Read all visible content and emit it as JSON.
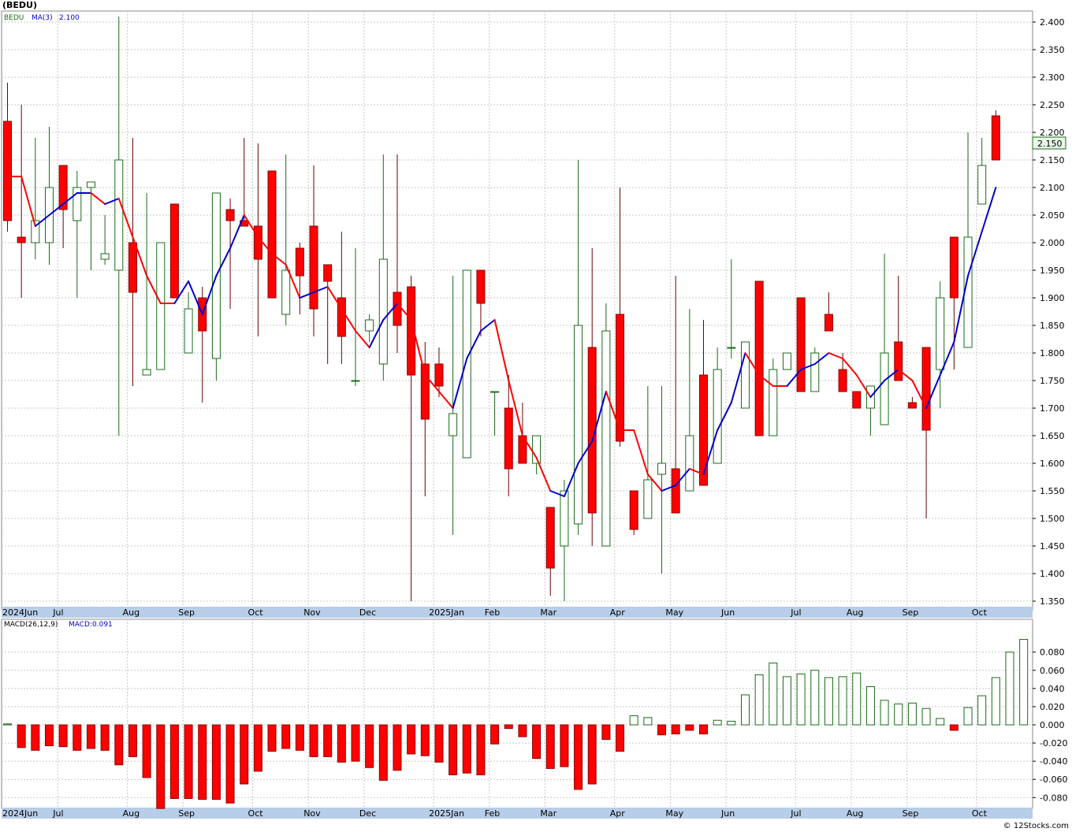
{
  "title": "(BEDU)",
  "copyright": "© 12Stocks.com",
  "colors": {
    "up": "#1a6b1a",
    "down": "#ff0000",
    "ma_up": "#0000cc",
    "ma_down": "#ff0000",
    "axis_band": "#b7cde8",
    "grid": "#c8c8c8"
  },
  "chart_data": [
    {
      "type": "candlestick",
      "legend": {
        "symbol": "BEDU",
        "ma_label": "MA(3)",
        "ma_value": "2.100"
      },
      "price_label": "2.150",
      "ylim": [
        1.34,
        2.42
      ],
      "y_ticks": [
        "1.350",
        "1.400",
        "1.450",
        "1.500",
        "1.550",
        "1.600",
        "1.650",
        "1.700",
        "1.750",
        "1.800",
        "1.850",
        "1.900",
        "1.950",
        "2.000",
        "2.050",
        "2.100",
        "2.150",
        "2.200",
        "2.250",
        "2.300",
        "2.350",
        "2.400"
      ],
      "x_ticks": [
        {
          "i": 0,
          "label": "2024Jun"
        },
        {
          "i": 4,
          "label": "Jul"
        },
        {
          "i": 9,
          "label": "Aug"
        },
        {
          "i": 13,
          "label": "Sep"
        },
        {
          "i": 18,
          "label": "Oct"
        },
        {
          "i": 22,
          "label": "Nov"
        },
        {
          "i": 26,
          "label": "Dec"
        },
        {
          "i": 31,
          "label": "2025Jan"
        },
        {
          "i": 35,
          "label": "Feb"
        },
        {
          "i": 39,
          "label": "Mar"
        },
        {
          "i": 44,
          "label": "Apr"
        },
        {
          "i": 48,
          "label": "May"
        },
        {
          "i": 52,
          "label": "Jun"
        },
        {
          "i": 57,
          "label": "Jul"
        },
        {
          "i": 61,
          "label": "Aug"
        },
        {
          "i": 65,
          "label": "Sep"
        },
        {
          "i": 70,
          "label": "Oct"
        }
      ],
      "candles": [
        {
          "o": 2.22,
          "h": 2.29,
          "l": 2.02,
          "c": 2.04
        },
        {
          "o": 2.01,
          "h": 2.25,
          "l": 1.9,
          "c": 2.0
        },
        {
          "o": 2.0,
          "h": 2.19,
          "l": 1.97,
          "c": 2.04
        },
        {
          "o": 2.0,
          "h": 2.21,
          "l": 1.96,
          "c": 2.1
        },
        {
          "o": 2.14,
          "h": 2.14,
          "l": 1.99,
          "c": 2.06
        },
        {
          "o": 2.04,
          "h": 2.13,
          "l": 1.9,
          "c": 2.1
        },
        {
          "o": 2.1,
          "h": 2.11,
          "l": 1.95,
          "c": 2.11
        },
        {
          "o": 1.97,
          "h": 2.05,
          "l": 1.96,
          "c": 1.98
        },
        {
          "o": 1.95,
          "h": 2.41,
          "l": 1.65,
          "c": 2.15
        },
        {
          "o": 2.0,
          "h": 2.19,
          "l": 1.74,
          "c": 1.91
        },
        {
          "o": 1.76,
          "h": 2.09,
          "l": 1.76,
          "c": 1.77
        },
        {
          "o": 1.77,
          "h": 2.0,
          "l": 1.77,
          "c": 2.0
        },
        {
          "o": 2.07,
          "h": 2.07,
          "l": 1.9,
          "c": 1.9
        },
        {
          "o": 1.8,
          "h": 1.91,
          "l": 1.8,
          "c": 1.88
        },
        {
          "o": 1.9,
          "h": 1.92,
          "l": 1.71,
          "c": 1.84
        },
        {
          "o": 1.79,
          "h": 2.09,
          "l": 1.75,
          "c": 2.09
        },
        {
          "o": 2.06,
          "h": 2.08,
          "l": 1.88,
          "c": 2.04
        },
        {
          "o": 2.04,
          "h": 2.19,
          "l": 2.03,
          "c": 2.03
        },
        {
          "o": 2.03,
          "h": 2.18,
          "l": 1.83,
          "c": 1.97
        },
        {
          "o": 2.13,
          "h": 2.13,
          "l": 1.9,
          "c": 1.9
        },
        {
          "o": 1.87,
          "h": 2.16,
          "l": 1.85,
          "c": 1.95
        },
        {
          "o": 1.99,
          "h": 2.0,
          "l": 1.87,
          "c": 1.94
        },
        {
          "o": 2.03,
          "h": 2.14,
          "l": 1.83,
          "c": 1.88
        },
        {
          "o": 1.96,
          "h": 1.96,
          "l": 1.78,
          "c": 1.93
        },
        {
          "o": 1.9,
          "h": 2.02,
          "l": 1.78,
          "c": 1.83
        },
        {
          "o": 1.75,
          "h": 1.99,
          "l": 1.74,
          "c": 1.75
        },
        {
          "o": 1.84,
          "h": 1.87,
          "l": 1.82,
          "c": 1.86
        },
        {
          "o": 1.78,
          "h": 2.16,
          "l": 1.75,
          "c": 1.97
        },
        {
          "o": 1.91,
          "h": 2.16,
          "l": 1.8,
          "c": 1.85
        },
        {
          "o": 1.92,
          "h": 1.94,
          "l": 1.35,
          "c": 1.76
        },
        {
          "o": 1.78,
          "h": 1.82,
          "l": 1.54,
          "c": 1.68
        },
        {
          "o": 1.78,
          "h": 1.81,
          "l": 1.72,
          "c": 1.74
        },
        {
          "o": 1.65,
          "h": 1.94,
          "l": 1.47,
          "c": 1.69
        },
        {
          "o": 1.61,
          "h": 1.95,
          "l": 1.61,
          "c": 1.95
        },
        {
          "o": 1.95,
          "h": 1.95,
          "l": 1.83,
          "c": 1.89
        },
        {
          "o": 1.73,
          "h": 1.73,
          "l": 1.65,
          "c": 1.73
        },
        {
          "o": 1.7,
          "h": 1.76,
          "l": 1.54,
          "c": 1.59
        },
        {
          "o": 1.65,
          "h": 1.71,
          "l": 1.6,
          "c": 1.6
        },
        {
          "o": 1.6,
          "h": 1.65,
          "l": 1.58,
          "c": 1.65
        },
        {
          "o": 1.52,
          "h": 1.52,
          "l": 1.36,
          "c": 1.41
        },
        {
          "o": 1.45,
          "h": 1.57,
          "l": 1.35,
          "c": 1.55
        },
        {
          "o": 1.49,
          "h": 2.15,
          "l": 1.47,
          "c": 1.85
        },
        {
          "o": 1.81,
          "h": 1.99,
          "l": 1.45,
          "c": 1.51
        },
        {
          "o": 1.45,
          "h": 1.89,
          "l": 1.45,
          "c": 1.84
        },
        {
          "o": 1.87,
          "h": 2.1,
          "l": 1.63,
          "c": 1.64
        },
        {
          "o": 1.55,
          "h": 1.55,
          "l": 1.47,
          "c": 1.48
        },
        {
          "o": 1.5,
          "h": 1.74,
          "l": 1.5,
          "c": 1.57
        },
        {
          "o": 1.58,
          "h": 1.74,
          "l": 1.4,
          "c": 1.6
        },
        {
          "o": 1.59,
          "h": 1.94,
          "l": 1.51,
          "c": 1.51
        },
        {
          "o": 1.55,
          "h": 1.88,
          "l": 1.55,
          "c": 1.65
        },
        {
          "o": 1.76,
          "h": 1.86,
          "l": 1.56,
          "c": 1.56
        },
        {
          "o": 1.6,
          "h": 1.81,
          "l": 1.6,
          "c": 1.77
        },
        {
          "o": 1.81,
          "h": 1.97,
          "l": 1.79,
          "c": 1.81
        },
        {
          "o": 1.7,
          "h": 1.82,
          "l": 1.7,
          "c": 1.82
        },
        {
          "o": 1.93,
          "h": 1.93,
          "l": 1.65,
          "c": 1.65
        },
        {
          "o": 1.65,
          "h": 1.79,
          "l": 1.65,
          "c": 1.77
        },
        {
          "o": 1.77,
          "h": 1.8,
          "l": 1.77,
          "c": 1.8
        },
        {
          "o": 1.9,
          "h": 1.9,
          "l": 1.73,
          "c": 1.73
        },
        {
          "o": 1.73,
          "h": 1.81,
          "l": 1.73,
          "c": 1.8
        },
        {
          "o": 1.87,
          "h": 1.91,
          "l": 1.84,
          "c": 1.84
        },
        {
          "o": 1.77,
          "h": 1.8,
          "l": 1.73,
          "c": 1.73
        },
        {
          "o": 1.73,
          "h": 1.73,
          "l": 1.7,
          "c": 1.7
        },
        {
          "o": 1.7,
          "h": 1.74,
          "l": 1.65,
          "c": 1.74
        },
        {
          "o": 1.67,
          "h": 1.98,
          "l": 1.67,
          "c": 1.8
        },
        {
          "o": 1.82,
          "h": 1.94,
          "l": 1.75,
          "c": 1.75
        },
        {
          "o": 1.71,
          "h": 1.72,
          "l": 1.7,
          "c": 1.7
        },
        {
          "o": 1.81,
          "h": 1.81,
          "l": 1.5,
          "c": 1.66
        },
        {
          "o": 1.77,
          "h": 1.93,
          "l": 1.7,
          "c": 1.9
        },
        {
          "o": 2.01,
          "h": 2.01,
          "l": 1.77,
          "c": 1.9
        },
        {
          "o": 1.81,
          "h": 2.2,
          "l": 1.81,
          "c": 2.01
        },
        {
          "o": 2.07,
          "h": 2.19,
          "l": 2.07,
          "c": 2.14
        },
        {
          "o": 2.23,
          "h": 2.24,
          "l": 2.15,
          "c": 2.15
        }
      ],
      "ma": [
        2.12,
        2.12,
        2.03,
        2.05,
        2.07,
        2.09,
        2.09,
        2.07,
        2.08,
        2.01,
        1.94,
        1.89,
        1.89,
        1.93,
        1.87,
        1.94,
        1.99,
        2.05,
        2.01,
        1.98,
        1.96,
        1.9,
        1.91,
        1.92,
        1.88,
        1.84,
        1.81,
        1.86,
        1.89,
        1.86,
        1.76,
        1.73,
        1.7,
        1.79,
        1.84,
        1.86,
        1.75,
        1.65,
        1.61,
        1.55,
        1.54,
        1.6,
        1.64,
        1.73,
        1.66,
        1.66,
        1.58,
        1.55,
        1.56,
        1.59,
        1.58,
        1.66,
        1.71,
        1.8,
        1.76,
        1.74,
        1.74,
        1.77,
        1.78,
        1.8,
        1.79,
        1.76,
        1.72,
        1.75,
        1.77,
        1.75,
        1.7,
        1.76,
        1.82,
        1.94,
        2.02,
        2.1
      ],
      "ma_up": [
        true,
        false,
        false,
        true,
        true,
        true,
        true,
        false,
        true,
        false,
        false,
        false,
        false,
        true,
        true,
        true,
        true,
        true,
        false,
        false,
        false,
        false,
        true,
        true,
        false,
        false,
        false,
        true,
        true,
        false,
        false,
        false,
        false,
        true,
        true,
        true,
        false,
        false,
        false,
        false,
        true,
        true,
        true,
        true,
        false,
        false,
        false,
        false,
        true,
        true,
        false,
        true,
        true,
        true,
        false,
        false,
        false,
        true,
        true,
        true,
        false,
        false,
        false,
        true,
        true,
        false,
        false,
        true,
        true,
        true,
        true,
        true
      ]
    },
    {
      "type": "bar",
      "legend": {
        "name": "MACD(26,12,9)",
        "value_label": "MACD:0.091"
      },
      "ylim": [
        -0.091,
        0.104
      ],
      "y_ticks": [
        "-0.080",
        "-0.060",
        "-0.040",
        "-0.020",
        "0.000",
        "0.020",
        "0.040",
        "0.060",
        "0.080"
      ],
      "values": [
        0.001,
        -0.025,
        -0.028,
        -0.023,
        -0.024,
        -0.028,
        -0.026,
        -0.028,
        -0.044,
        -0.035,
        -0.058,
        -0.092,
        -0.081,
        -0.081,
        -0.082,
        -0.082,
        -0.086,
        -0.065,
        -0.051,
        -0.029,
        -0.026,
        -0.028,
        -0.035,
        -0.035,
        -0.041,
        -0.04,
        -0.047,
        -0.061,
        -0.05,
        -0.032,
        -0.034,
        -0.041,
        -0.055,
        -0.053,
        -0.055,
        -0.021,
        -0.004,
        -0.013,
        -0.037,
        -0.048,
        -0.046,
        -0.071,
        -0.065,
        -0.016,
        -0.029,
        0.01,
        0.008,
        -0.011,
        -0.01,
        -0.006,
        -0.01,
        0.005,
        0.004,
        0.033,
        0.055,
        0.068,
        0.053,
        0.056,
        0.06,
        0.052,
        0.053,
        0.057,
        0.042,
        0.027,
        0.023,
        0.024,
        0.018,
        0.007,
        -0.006,
        0.019,
        0.032,
        0.052,
        0.08,
        0.094
      ]
    }
  ]
}
